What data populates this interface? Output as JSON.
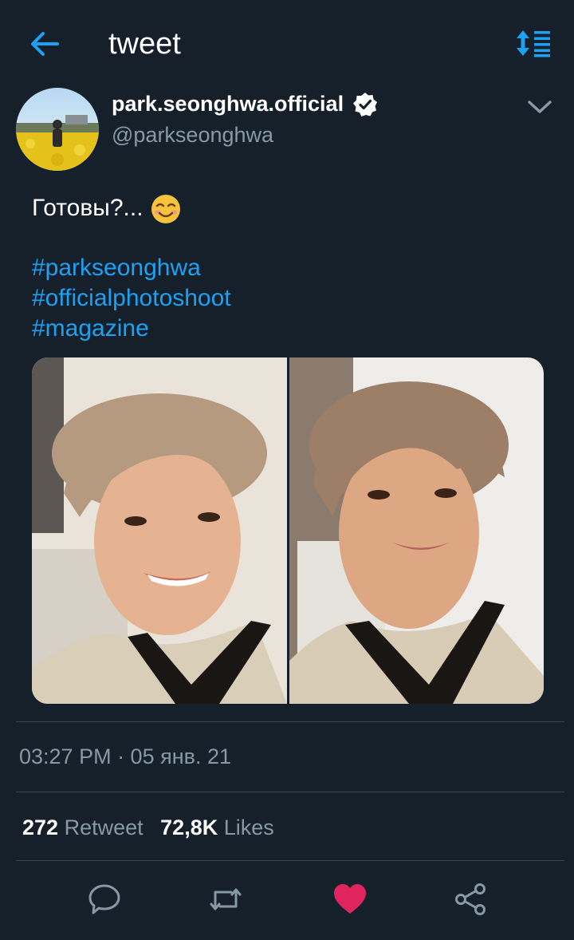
{
  "colors": {
    "background": "#15202b",
    "accent": "#1da1f2",
    "muted": "#8899a6",
    "divider": "#38444d",
    "like": "#e0245e"
  },
  "header": {
    "title": "tweet",
    "back_icon": "arrow-left-icon",
    "sort_icon": "sort-list-icon"
  },
  "author": {
    "display_name": "park.seonghwa.official",
    "handle": "@parkseonghwa",
    "verified_icon": "verified-badge-icon",
    "more_icon": "chevron-down-icon"
  },
  "tweet": {
    "text": "Готовы?...",
    "emoji": "smiling-face-emoji",
    "hashtags": [
      "#parkseonghwa",
      "#officialphotoshoot",
      "#magazine"
    ],
    "timestamp": "03:27 PM · 05 янв. 21"
  },
  "stats": {
    "retweets_count": "272",
    "retweets_label": "Retweet",
    "likes_count": "72,8K",
    "likes_label": "Likes"
  },
  "actions": {
    "reply_icon": "reply-icon",
    "retweet_icon": "retweet-icon",
    "like_icon": "heart-icon",
    "share_icon": "share-icon"
  }
}
